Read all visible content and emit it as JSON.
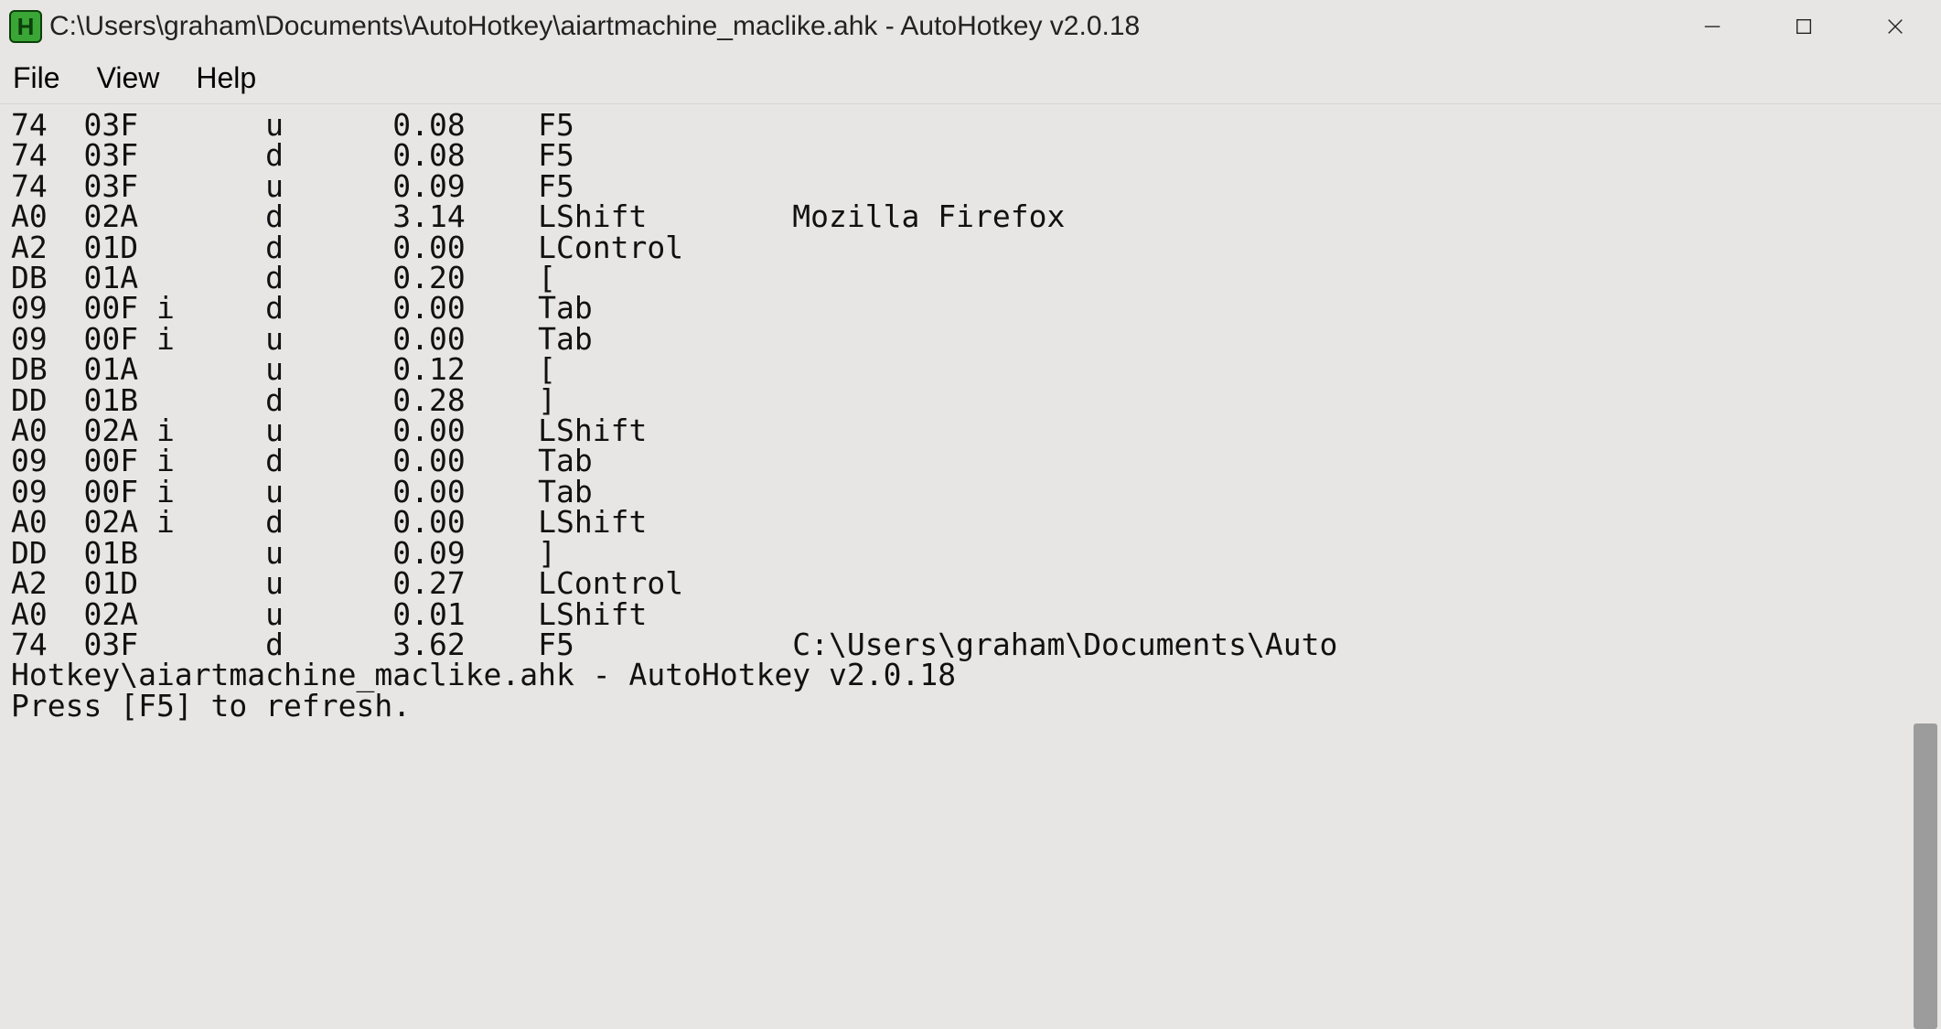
{
  "titlebar": {
    "icon_letter": "H",
    "title": "C:\\Users\\graham\\Documents\\AutoHotkey\\aiartmachine_maclike.ahk - AutoHotkey v2.0.18"
  },
  "menu": {
    "file": "File",
    "view": "View",
    "help": "Help"
  },
  "log": {
    "rows": [
      {
        "vk": "74",
        "sc": "03F",
        "flag": "",
        "ud": "u",
        "elapsed": "0.08",
        "key": "F5",
        "window": ""
      },
      {
        "vk": "74",
        "sc": "03F",
        "flag": "",
        "ud": "d",
        "elapsed": "0.08",
        "key": "F5",
        "window": ""
      },
      {
        "vk": "74",
        "sc": "03F",
        "flag": "",
        "ud": "u",
        "elapsed": "0.09",
        "key": "F5",
        "window": ""
      },
      {
        "vk": "A0",
        "sc": "02A",
        "flag": "",
        "ud": "d",
        "elapsed": "3.14",
        "key": "LShift",
        "window": "Mozilla Firefox"
      },
      {
        "vk": "A2",
        "sc": "01D",
        "flag": "",
        "ud": "d",
        "elapsed": "0.00",
        "key": "LControl",
        "window": ""
      },
      {
        "vk": "DB",
        "sc": "01A",
        "flag": "",
        "ud": "d",
        "elapsed": "0.20",
        "key": "[",
        "window": ""
      },
      {
        "vk": "09",
        "sc": "00F",
        "flag": "i",
        "ud": "d",
        "elapsed": "0.00",
        "key": "Tab",
        "window": ""
      },
      {
        "vk": "09",
        "sc": "00F",
        "flag": "i",
        "ud": "u",
        "elapsed": "0.00",
        "key": "Tab",
        "window": ""
      },
      {
        "vk": "DB",
        "sc": "01A",
        "flag": "",
        "ud": "u",
        "elapsed": "0.12",
        "key": "[",
        "window": ""
      },
      {
        "vk": "DD",
        "sc": "01B",
        "flag": "",
        "ud": "d",
        "elapsed": "0.28",
        "key": "]",
        "window": ""
      },
      {
        "vk": "A0",
        "sc": "02A",
        "flag": "i",
        "ud": "u",
        "elapsed": "0.00",
        "key": "LShift",
        "window": ""
      },
      {
        "vk": "09",
        "sc": "00F",
        "flag": "i",
        "ud": "d",
        "elapsed": "0.00",
        "key": "Tab",
        "window": ""
      },
      {
        "vk": "09",
        "sc": "00F",
        "flag": "i",
        "ud": "u",
        "elapsed": "0.00",
        "key": "Tab",
        "window": ""
      },
      {
        "vk": "A0",
        "sc": "02A",
        "flag": "i",
        "ud": "d",
        "elapsed": "0.00",
        "key": "LShift",
        "window": ""
      },
      {
        "vk": "DD",
        "sc": "01B",
        "flag": "",
        "ud": "u",
        "elapsed": "0.09",
        "key": "]",
        "window": ""
      },
      {
        "vk": "A2",
        "sc": "01D",
        "flag": "",
        "ud": "u",
        "elapsed": "0.27",
        "key": "LControl",
        "window": ""
      },
      {
        "vk": "A0",
        "sc": "02A",
        "flag": "",
        "ud": "u",
        "elapsed": "0.01",
        "key": "LShift",
        "window": ""
      },
      {
        "vk": "74",
        "sc": "03F",
        "flag": "",
        "ud": "d",
        "elapsed": "3.62",
        "key": "F5",
        "window": "C:\\Users\\graham\\Documents\\AutoHotkey\\aiartmachine_maclike.ahk - AutoHotkey v2.0.18"
      }
    ],
    "footer": "Press [F5] to refresh."
  },
  "scrollbar": {
    "thumb_top_pct": 67,
    "thumb_height_pct": 33
  }
}
